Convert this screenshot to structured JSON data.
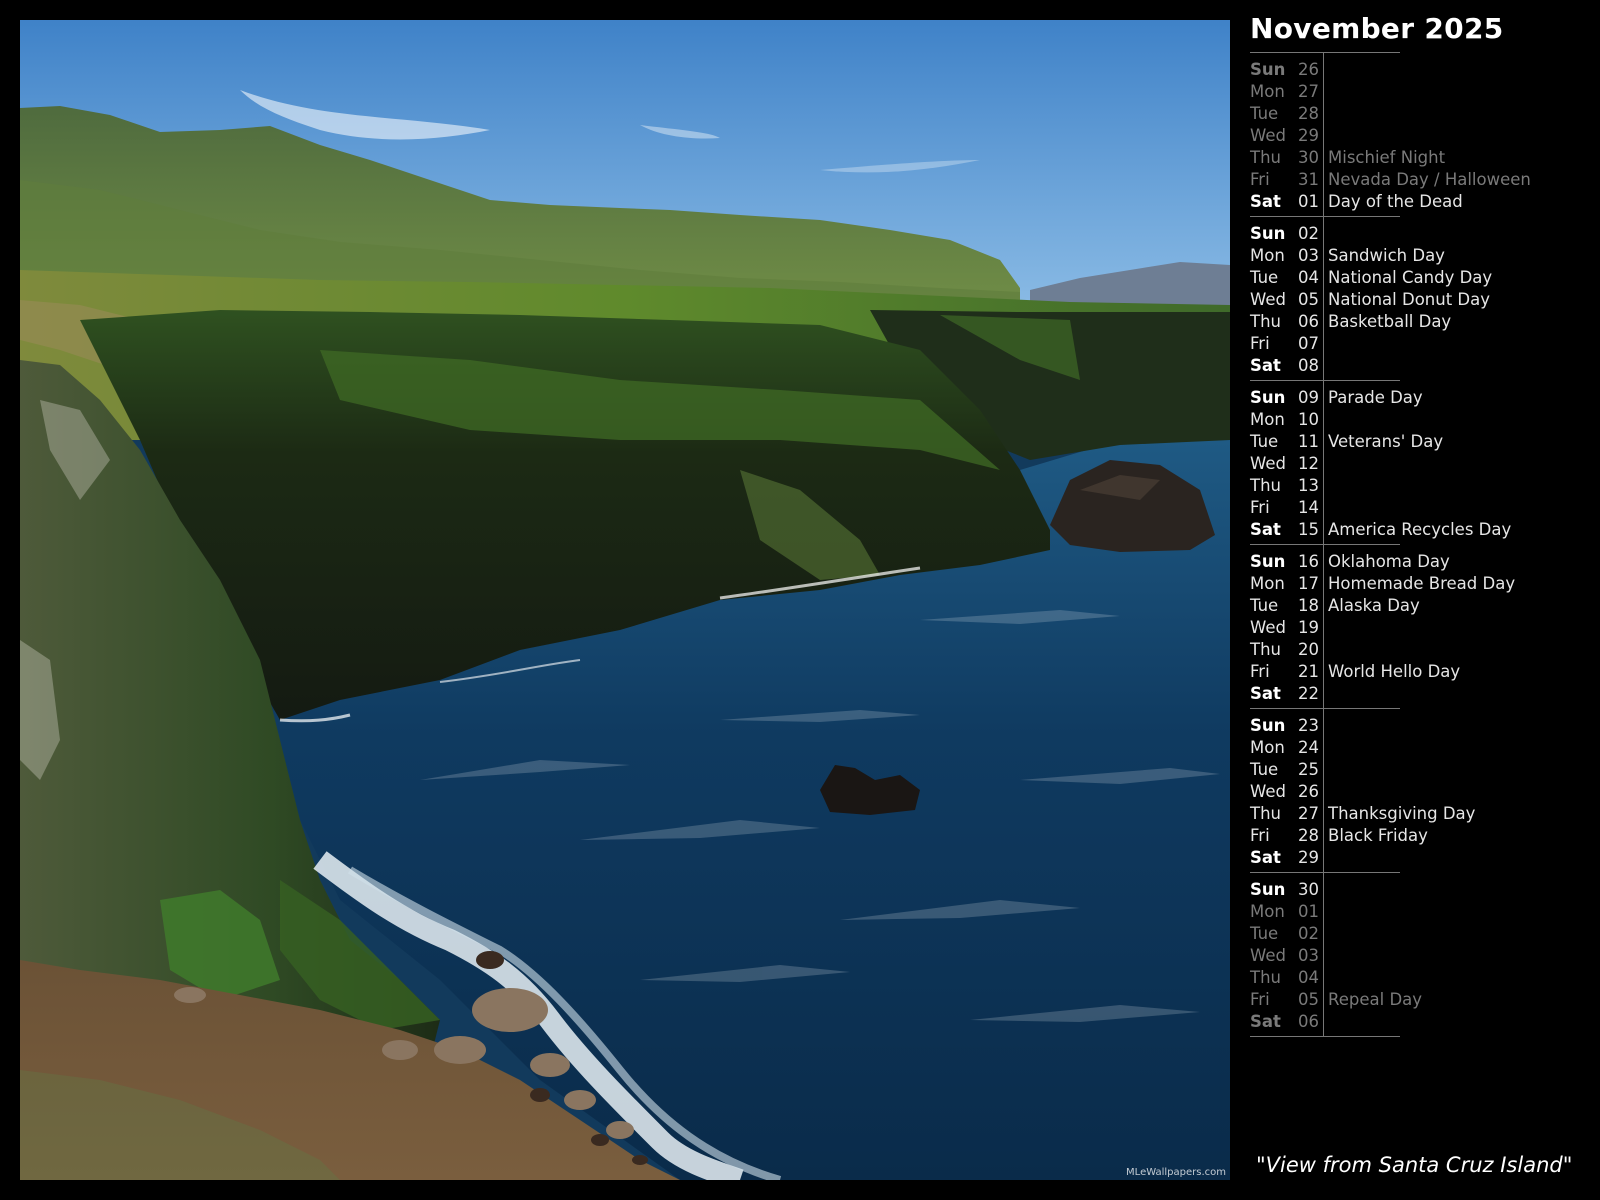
{
  "calendar": {
    "title": "November 2025",
    "weeks": [
      [
        {
          "day": "Sun",
          "num": "26",
          "holiday": "",
          "current": false,
          "weekend": true
        },
        {
          "day": "Mon",
          "num": "27",
          "holiday": "",
          "current": false,
          "weekend": false
        },
        {
          "day": "Tue",
          "num": "28",
          "holiday": "",
          "current": false,
          "weekend": false
        },
        {
          "day": "Wed",
          "num": "29",
          "holiday": "",
          "current": false,
          "weekend": false
        },
        {
          "day": "Thu",
          "num": "30",
          "holiday": "Mischief Night",
          "current": false,
          "weekend": false
        },
        {
          "day": "Fri",
          "num": "31",
          "holiday": "Nevada Day / Halloween",
          "current": false,
          "weekend": false
        },
        {
          "day": "Sat",
          "num": "01",
          "holiday": "Day of the Dead",
          "current": true,
          "weekend": true
        }
      ],
      [
        {
          "day": "Sun",
          "num": "02",
          "holiday": "",
          "current": true,
          "weekend": true
        },
        {
          "day": "Mon",
          "num": "03",
          "holiday": "Sandwich Day",
          "current": true,
          "weekend": false
        },
        {
          "day": "Tue",
          "num": "04",
          "holiday": "National Candy Day",
          "current": true,
          "weekend": false
        },
        {
          "day": "Wed",
          "num": "05",
          "holiday": "National Donut Day",
          "current": true,
          "weekend": false
        },
        {
          "day": "Thu",
          "num": "06",
          "holiday": "Basketball Day",
          "current": true,
          "weekend": false
        },
        {
          "day": "Fri",
          "num": "07",
          "holiday": "",
          "current": true,
          "weekend": false
        },
        {
          "day": "Sat",
          "num": "08",
          "holiday": "",
          "current": true,
          "weekend": true
        }
      ],
      [
        {
          "day": "Sun",
          "num": "09",
          "holiday": "Parade Day",
          "current": true,
          "weekend": true
        },
        {
          "day": "Mon",
          "num": "10",
          "holiday": "",
          "current": true,
          "weekend": false
        },
        {
          "day": "Tue",
          "num": "11",
          "holiday": "Veterans' Day",
          "current": true,
          "weekend": false
        },
        {
          "day": "Wed",
          "num": "12",
          "holiday": "",
          "current": true,
          "weekend": false
        },
        {
          "day": "Thu",
          "num": "13",
          "holiday": "",
          "current": true,
          "weekend": false
        },
        {
          "day": "Fri",
          "num": "14",
          "holiday": "",
          "current": true,
          "weekend": false
        },
        {
          "day": "Sat",
          "num": "15",
          "holiday": "America Recycles Day",
          "current": true,
          "weekend": true
        }
      ],
      [
        {
          "day": "Sun",
          "num": "16",
          "holiday": "Oklahoma Day",
          "current": true,
          "weekend": true
        },
        {
          "day": "Mon",
          "num": "17",
          "holiday": "Homemade Bread Day",
          "current": true,
          "weekend": false
        },
        {
          "day": "Tue",
          "num": "18",
          "holiday": "Alaska Day",
          "current": true,
          "weekend": false
        },
        {
          "day": "Wed",
          "num": "19",
          "holiday": "",
          "current": true,
          "weekend": false
        },
        {
          "day": "Thu",
          "num": "20",
          "holiday": "",
          "current": true,
          "weekend": false
        },
        {
          "day": "Fri",
          "num": "21",
          "holiday": "World Hello Day",
          "current": true,
          "weekend": false
        },
        {
          "day": "Sat",
          "num": "22",
          "holiday": "",
          "current": true,
          "weekend": true
        }
      ],
      [
        {
          "day": "Sun",
          "num": "23",
          "holiday": "",
          "current": true,
          "weekend": true
        },
        {
          "day": "Mon",
          "num": "24",
          "holiday": "",
          "current": true,
          "weekend": false
        },
        {
          "day": "Tue",
          "num": "25",
          "holiday": "",
          "current": true,
          "weekend": false
        },
        {
          "day": "Wed",
          "num": "26",
          "holiday": "",
          "current": true,
          "weekend": false
        },
        {
          "day": "Thu",
          "num": "27",
          "holiday": "Thanksgiving Day",
          "current": true,
          "weekend": false
        },
        {
          "day": "Fri",
          "num": "28",
          "holiday": "Black Friday",
          "current": true,
          "weekend": false
        },
        {
          "day": "Sat",
          "num": "29",
          "holiday": "",
          "current": true,
          "weekend": true
        }
      ],
      [
        {
          "day": "Sun",
          "num": "30",
          "holiday": "",
          "current": true,
          "weekend": true
        },
        {
          "day": "Mon",
          "num": "01",
          "holiday": "",
          "current": false,
          "weekend": false
        },
        {
          "day": "Tue",
          "num": "02",
          "holiday": "",
          "current": false,
          "weekend": false
        },
        {
          "day": "Wed",
          "num": "03",
          "holiday": "",
          "current": false,
          "weekend": false
        },
        {
          "day": "Thu",
          "num": "04",
          "holiday": "",
          "current": false,
          "weekend": false
        },
        {
          "day": "Fri",
          "num": "05",
          "holiday": "Repeal Day",
          "current": false,
          "weekend": false
        },
        {
          "day": "Sat",
          "num": "06",
          "holiday": "",
          "current": false,
          "weekend": true
        }
      ]
    ]
  },
  "photo": {
    "caption": "\"View from Santa Cruz Island\"",
    "watermark": "MLeWallpapers.com"
  },
  "colors": {
    "background": "#000000",
    "sky": "#4f8fcc",
    "sea": "#0e3457",
    "cliff_green": "#3f6a28",
    "text_current": "#e6e6e6",
    "text_other": "#7a7a7a",
    "divider": "#777777"
  }
}
